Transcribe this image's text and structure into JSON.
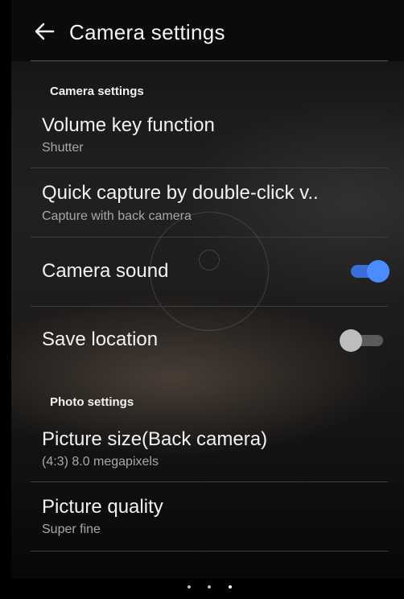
{
  "app_bar": {
    "title": "Camera settings",
    "back_icon": "arrow-left-icon"
  },
  "sections": [
    {
      "header": "Camera settings",
      "items": [
        {
          "title": "Volume key function",
          "subtitle": "Shutter"
        },
        {
          "title": "Quick capture by double-click v..",
          "subtitle": "Capture with back camera"
        },
        {
          "title": "Camera sound",
          "toggle": true
        },
        {
          "title": "Save location",
          "toggle": false
        }
      ]
    },
    {
      "header": "Photo settings",
      "items": [
        {
          "title": "Picture size(Back camera)",
          "subtitle": "(4:3) 8.0 megapixels"
        },
        {
          "title": "Picture quality",
          "subtitle": "Super fine"
        }
      ]
    }
  ],
  "colors": {
    "toggle_on_track": "#3a6fd8",
    "toggle_on_thumb": "#4a8cff",
    "toggle_off_track": "#5b5b5b",
    "toggle_off_thumb": "#bdbdbd"
  },
  "page_indicator": {
    "count": 3,
    "active_index": 2
  }
}
